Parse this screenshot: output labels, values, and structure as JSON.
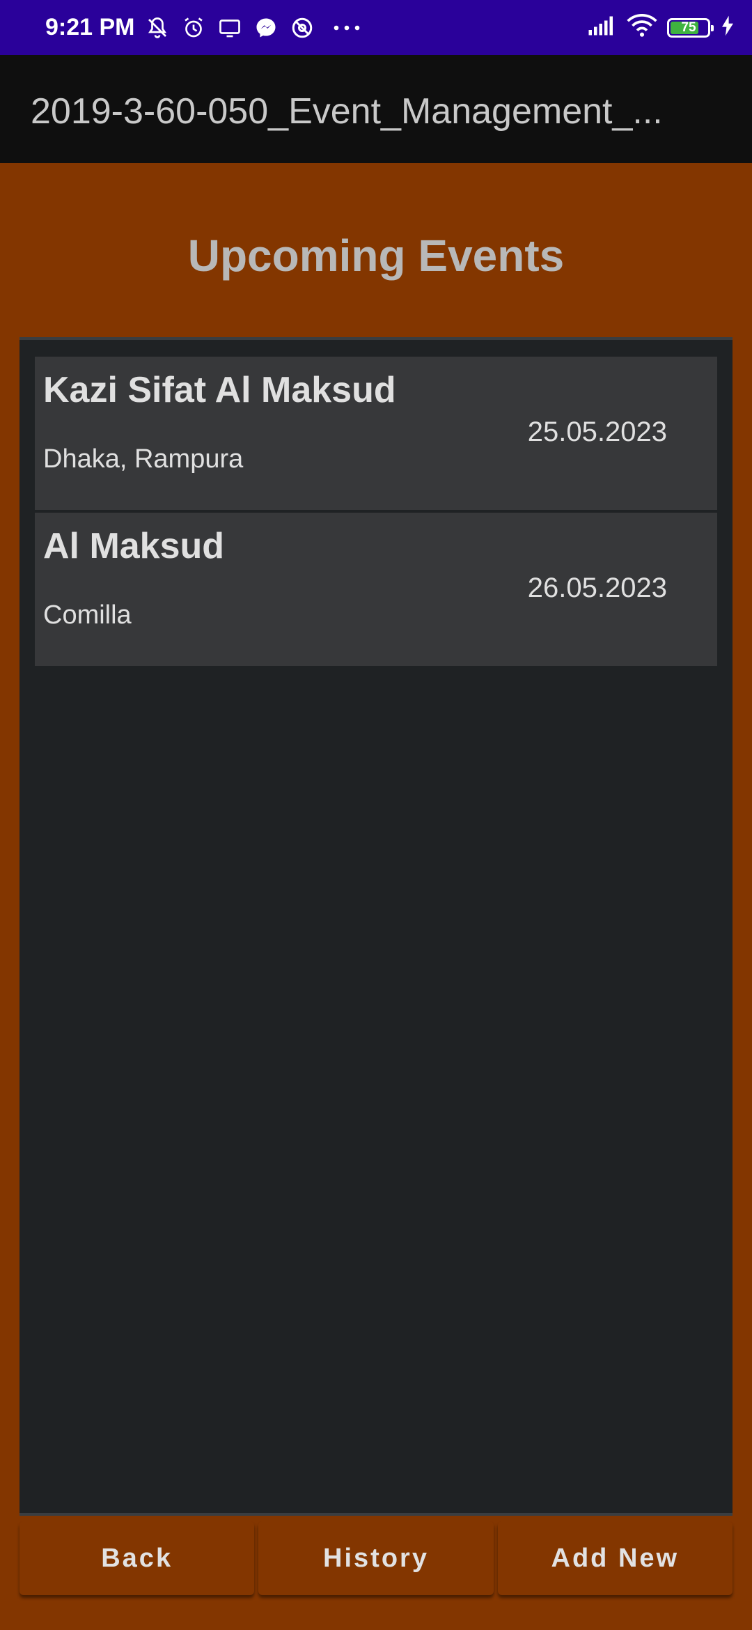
{
  "status_bar": {
    "time": "9:21 PM",
    "battery_level": "75",
    "icons_left": [
      "bell-off-icon",
      "alarm-icon",
      "screen-icon",
      "messenger-icon",
      "at-icon",
      "more-dots-icon"
    ],
    "icons_right": [
      "signal-icon",
      "wifi-icon",
      "battery-icon",
      "charging-icon"
    ]
  },
  "app_bar": {
    "title": "2019-3-60-050_Event_Management_..."
  },
  "page": {
    "heading": "Upcoming Events"
  },
  "events": [
    {
      "name": "Kazi Sifat Al Maksud",
      "location": "Dhaka, Rampura",
      "date": "25.05.2023"
    },
    {
      "name": "Al Maksud",
      "location": "Comilla",
      "date": "26.05.2023"
    }
  ],
  "buttons": {
    "back": "Back",
    "history": "History",
    "add_new": "Add New"
  },
  "colors": {
    "status_bar": "#2a019a",
    "app_bar": "#0f0f0f",
    "background": "#833600",
    "list_background": "#1f2224",
    "row_background": "#37383a"
  }
}
